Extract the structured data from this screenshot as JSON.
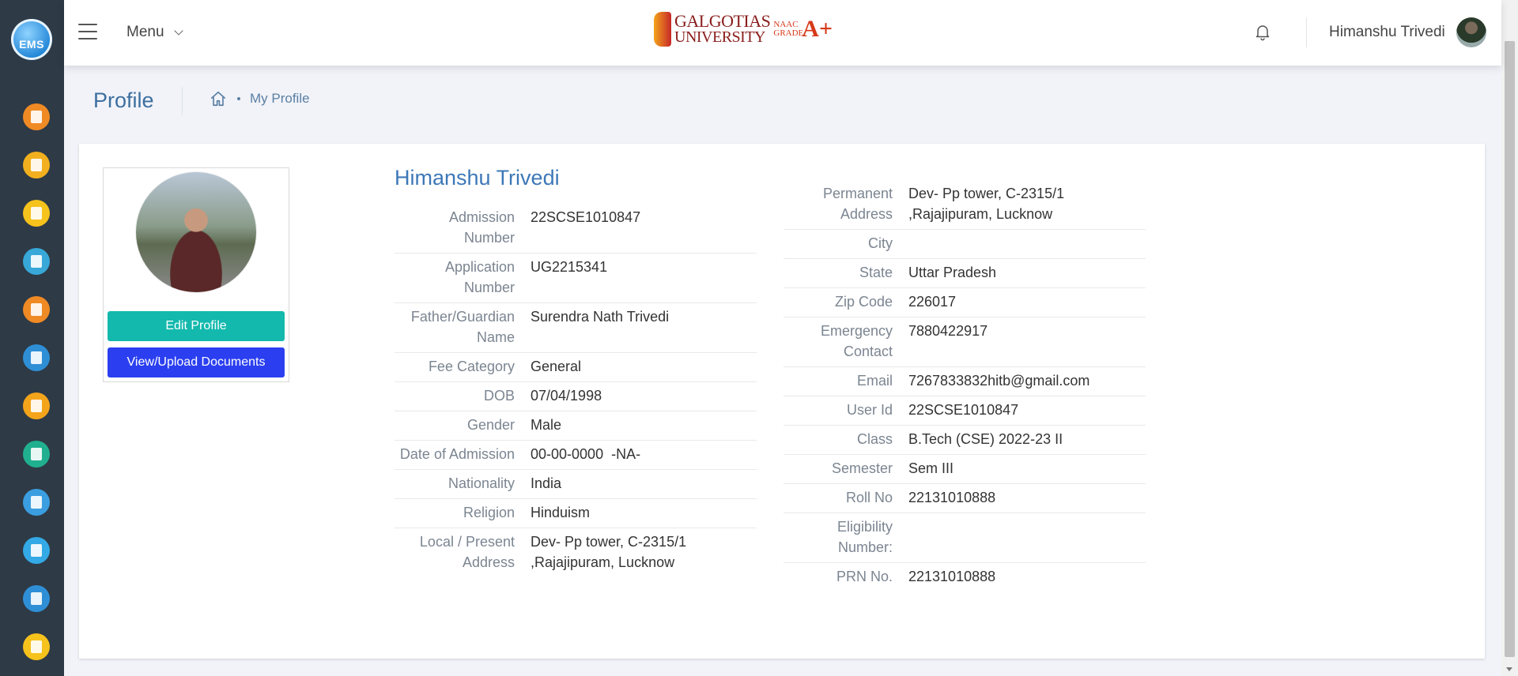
{
  "header": {
    "menu_label": "Menu",
    "brand": {
      "name_top": "GALGOTIAS",
      "name_bottom": "UNIVERSITY",
      "naac_line1": "NAAC",
      "naac_line2": "GRADE",
      "naac_grade": "A+"
    },
    "user_name": "Himanshu Trivedi"
  },
  "sidebar": {
    "logo_text": "EMS"
  },
  "page": {
    "title": "Profile",
    "breadcrumb": "My Profile"
  },
  "profile": {
    "name": "Himanshu Trivedi",
    "edit_button": "Edit Profile",
    "documents_button": "View/Upload Documents",
    "left_fields": [
      {
        "label": "Admission Number",
        "value": "22SCSE1010847"
      },
      {
        "label": "Application Number",
        "value": "UG2215341"
      },
      {
        "label": "Father/Guardian Name",
        "value": "Surendra Nath Trivedi"
      },
      {
        "label": "Fee Category",
        "value": "General"
      },
      {
        "label": "DOB",
        "value": "07/04/1998"
      },
      {
        "label": "Gender",
        "value": "Male"
      },
      {
        "label": "Date of Admission",
        "value": "00-00-0000  -NA-"
      },
      {
        "label": "Nationality",
        "value": "India"
      },
      {
        "label": "Religion",
        "value": "Hinduism"
      },
      {
        "label": "Local / Present Address",
        "value": "Dev- Pp tower, C-2315/1 ,Rajajipuram, Lucknow"
      }
    ],
    "right_fields": [
      {
        "label": "Permanent Address",
        "value": "Dev- Pp tower, C-2315/1 ,Rajajipuram, Lucknow"
      },
      {
        "label": "City",
        "value": ""
      },
      {
        "label": "State",
        "value": "Uttar Pradesh"
      },
      {
        "label": "Zip Code",
        "value": "226017"
      },
      {
        "label": "Emergency Contact",
        "value": "7880422917"
      },
      {
        "label": "Email",
        "value": "7267833832hitb@gmail.com"
      },
      {
        "label": "User Id",
        "value": "22SCSE1010847"
      },
      {
        "label": "Class",
        "value": "B.Tech (CSE) 2022-23 II"
      },
      {
        "label": "Semester",
        "value": "Sem III"
      },
      {
        "label": "Roll No",
        "value": "22131010888"
      },
      {
        "label": "Eligibility Number:",
        "value": ""
      },
      {
        "label": "PRN No.",
        "value": "22131010888"
      }
    ]
  },
  "colors": {
    "sidebar_bg": "#2e3a46",
    "accent_blue": "#3d78b7",
    "edit_button": "#13b9ad",
    "docs_button": "#2b3ff0"
  }
}
